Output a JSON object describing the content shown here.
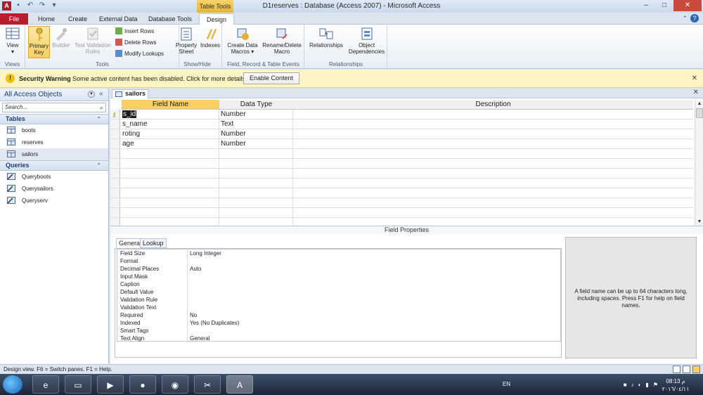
{
  "title_bar": {
    "app_icon": "A",
    "context_tab": "Table Tools",
    "window_title": "D1reserves : Database (Access 2007)  -  Microsoft Access",
    "buttons": {
      "minimize": "–",
      "maximize": "□",
      "close": "✕"
    }
  },
  "tabs": [
    "File",
    "Home",
    "Create",
    "External Data",
    "Database Tools",
    "Design"
  ],
  "ribbon": {
    "groups": {
      "views": "Views",
      "tools": "Tools",
      "show_hide": "Show/Hide",
      "field_record_events": "Field, Record & Table Events",
      "relationships": "Relationships"
    },
    "buttons": {
      "view": "View",
      "primary_key": "Primary Key",
      "builder": "Builder",
      "test_validation": "Test Validation Rules",
      "insert_rows": "Insert Rows",
      "delete_rows": "Delete Rows",
      "modify_lookups": "Modify Lookups",
      "property_sheet": "Property Sheet",
      "indexes": "Indexes",
      "create_data_macros": "Create Data Macros",
      "rename_delete_macro": "Rename/Delete Macro",
      "relationships": "Relationships",
      "object_dependencies": "Object Dependencies"
    }
  },
  "security_bar": {
    "title": "Security Warning",
    "message": "Some active content has been disabled. Click for more details.",
    "button": "Enable Content",
    "close": "✕"
  },
  "nav_pane": {
    "title": "All Access Objects",
    "search_placeholder": "Search...",
    "categories": [
      {
        "label": "Tables",
        "items": [
          "boots",
          "reserves",
          "sailors"
        ]
      },
      {
        "label": "Queries",
        "items": [
          "Queryboots",
          "Querysailors",
          "Queryserv"
        ]
      }
    ]
  },
  "document": {
    "tab_label": "sailors",
    "columns": [
      "Field Name",
      "Data Type",
      "Description"
    ],
    "rows": [
      {
        "field": "s_id",
        "type": "Number"
      },
      {
        "field": "s_name",
        "type": "Text"
      },
      {
        "field": "roting",
        "type": "Number"
      },
      {
        "field": "age",
        "type": "Number"
      }
    ]
  },
  "field_properties": {
    "title": "Field Properties",
    "tabs": [
      "General",
      "Lookup"
    ],
    "properties": [
      {
        "name": "Field Size",
        "value": "Long Integer"
      },
      {
        "name": "Format",
        "value": ""
      },
      {
        "name": "Decimal Places",
        "value": "Auto"
      },
      {
        "name": "Input Mask",
        "value": ""
      },
      {
        "name": "Caption",
        "value": ""
      },
      {
        "name": "Default Value",
        "value": ""
      },
      {
        "name": "Validation Rule",
        "value": ""
      },
      {
        "name": "Validation Text",
        "value": ""
      },
      {
        "name": "Required",
        "value": "No"
      },
      {
        "name": "Indexed",
        "value": "Yes (No Duplicates)"
      },
      {
        "name": "Smart Tags",
        "value": ""
      },
      {
        "name": "Text Align",
        "value": "General"
      }
    ],
    "help": "A field name can be up to 64 characters long, including spaces. Press F1 for help on field names."
  },
  "status_bar": {
    "text": "Design view.  F6 = Switch panes.  F1 = Help."
  },
  "taskbar": {
    "language": "EN",
    "time": "08:13 م",
    "date": "٢٠١٦/٠٤/١١"
  },
  "colors": {
    "file_tab": "#b81d2e",
    "context_tab": "#e6b332",
    "security_bar": "#fff4c3"
  }
}
